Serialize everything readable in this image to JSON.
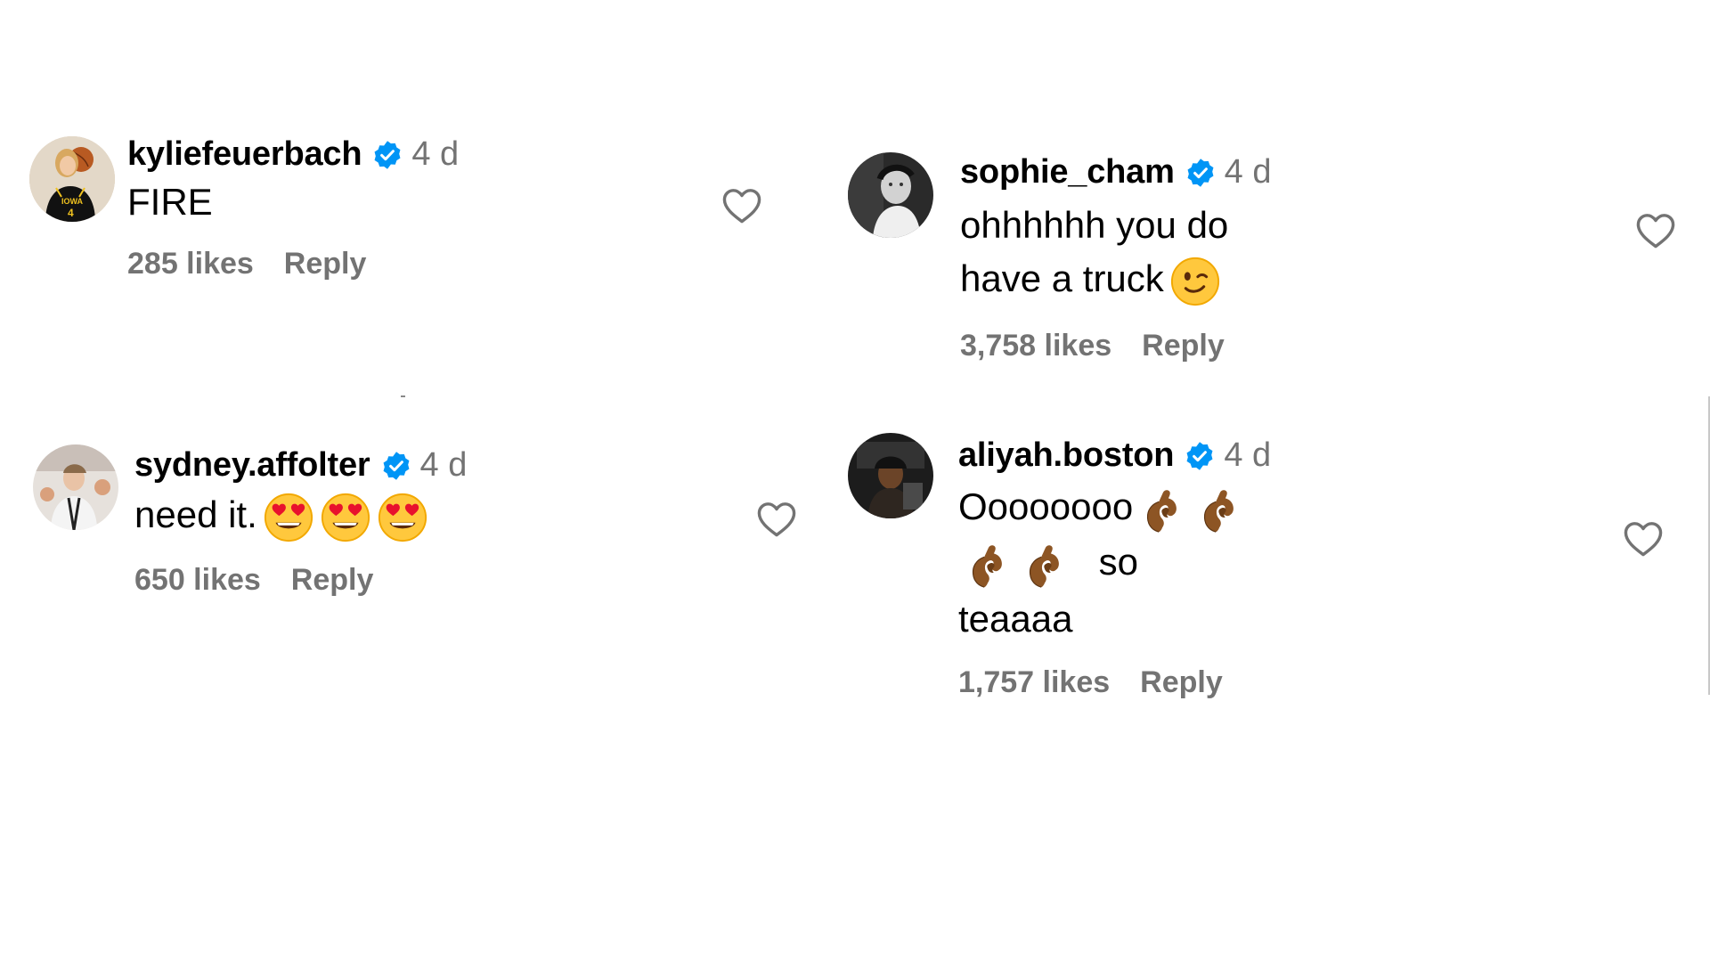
{
  "comments": [
    {
      "username": "kyliefeuerbach",
      "time": "4 d",
      "text": "FIRE",
      "likes": "285 likes",
      "reply": "Reply",
      "jersey_text": "IOWA",
      "jersey_number": "4"
    },
    {
      "username": "sophie_cham",
      "time": "4 d",
      "text": "ohhhhhh you do have a truck",
      "likes": "3,758 likes",
      "reply": "Reply"
    },
    {
      "username": "sydney.affolter",
      "time": "4 d",
      "text": "need it.",
      "likes": "650 likes",
      "reply": "Reply"
    },
    {
      "username": "aliyah.boston",
      "time": "4 d",
      "text_line1": "Oooooooo",
      "text_line1_end": "so",
      "text_line2": "teaaaa",
      "likes": "1,757 likes",
      "reply": "Reply"
    }
  ],
  "colors": {
    "verified_badge": "#0095f6",
    "secondary_text": "#737373",
    "primary_text": "#000000"
  },
  "icons": {
    "verified": "verified-badge-icon",
    "like": "heart-outline-icon",
    "wink": "winking-face-emoji",
    "heart_eyes": "heart-eyes-emoji",
    "pinch": "pinching-hand-emoji"
  }
}
